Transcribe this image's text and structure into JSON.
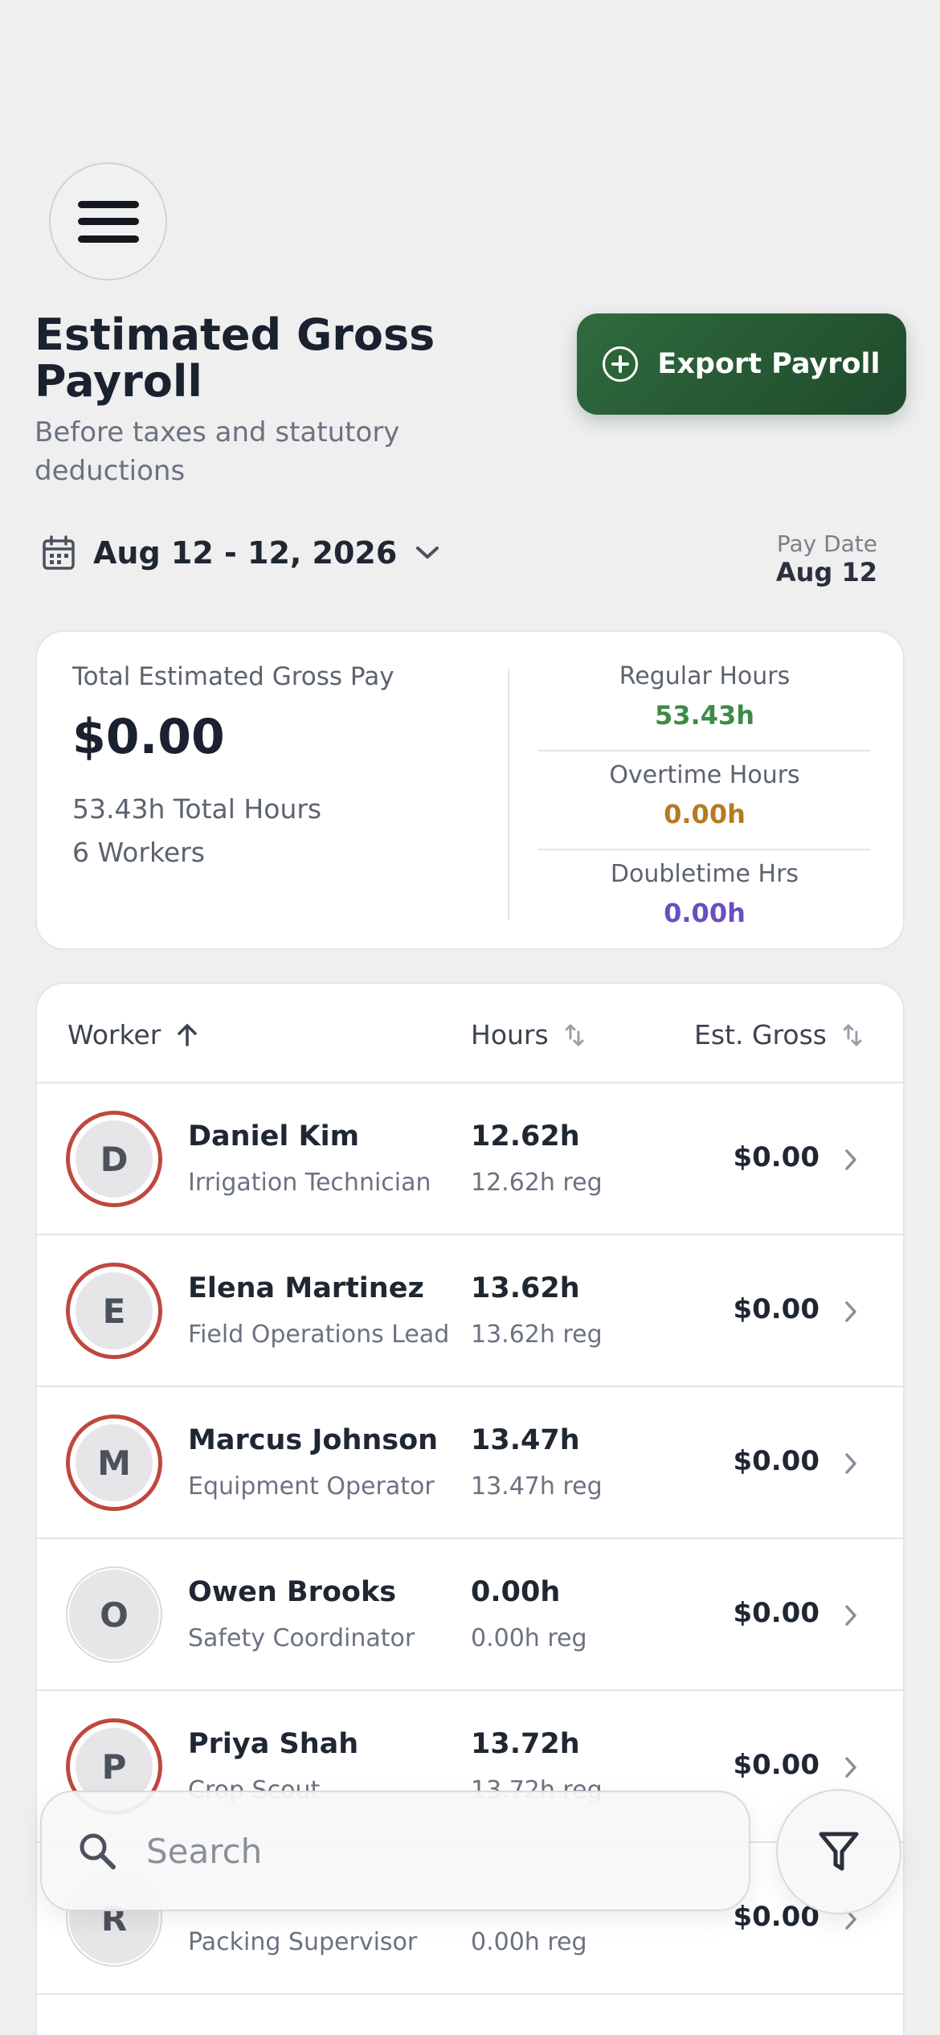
{
  "header": {
    "title": "Estimated Gross Payroll",
    "subtitle": "Before taxes and statutory deductions",
    "export_label": "Export Payroll"
  },
  "date_range": {
    "label": "Aug 12 - 12, 2026",
    "pay_date_label": "Pay Date",
    "pay_date_value": "Aug 12"
  },
  "summary": {
    "total_label": "Total Estimated Gross Pay",
    "total_value": "$0.00",
    "total_hours": "53.43h Total Hours",
    "workers": "6 Workers",
    "stats": [
      {
        "label": "Regular Hours",
        "value": "53.43h",
        "color": "#3d8b46"
      },
      {
        "label": "Overtime Hours",
        "value": "0.00h",
        "color": "#b67a1f"
      },
      {
        "label": "Doubletime Hrs",
        "value": "0.00h",
        "color": "#6a4fc0"
      }
    ]
  },
  "table": {
    "columns": {
      "worker": "Worker",
      "hours": "Hours",
      "gross": "Est. Gross"
    },
    "rows": [
      {
        "initial": "D",
        "name": "Daniel Kim",
        "role": "Irrigation Technician",
        "hours": "12.62h",
        "reg": "12.62h reg",
        "gross": "$0.00",
        "ring": true
      },
      {
        "initial": "E",
        "name": "Elena Martinez",
        "role": "Field Operations Lead",
        "hours": "13.62h",
        "reg": "13.62h reg",
        "gross": "$0.00",
        "ring": true
      },
      {
        "initial": "M",
        "name": "Marcus Johnson",
        "role": "Equipment Operator",
        "hours": "13.47h",
        "reg": "13.47h reg",
        "gross": "$0.00",
        "ring": true
      },
      {
        "initial": "O",
        "name": "Owen Brooks",
        "role": "Safety Coordinator",
        "hours": "0.00h",
        "reg": "0.00h reg",
        "gross": "$0.00",
        "ring": false
      },
      {
        "initial": "P",
        "name": "Priya Shah",
        "role": "Crop Scout",
        "hours": "13.72h",
        "reg": "13.72h reg",
        "gross": "$0.00",
        "ring": true
      },
      {
        "initial": "R",
        "name": "",
        "role": "Packing Supervisor",
        "hours": "",
        "reg": "0.00h reg",
        "gross": "$0.00",
        "ring": false
      }
    ]
  },
  "search": {
    "placeholder": "Search"
  },
  "icons": [
    "menu-icon",
    "plus-circle-icon",
    "calendar-icon",
    "chevron-down-icon",
    "sort-up-icon",
    "sort-icon",
    "chevron-right-icon",
    "search-icon",
    "filter-icon"
  ]
}
